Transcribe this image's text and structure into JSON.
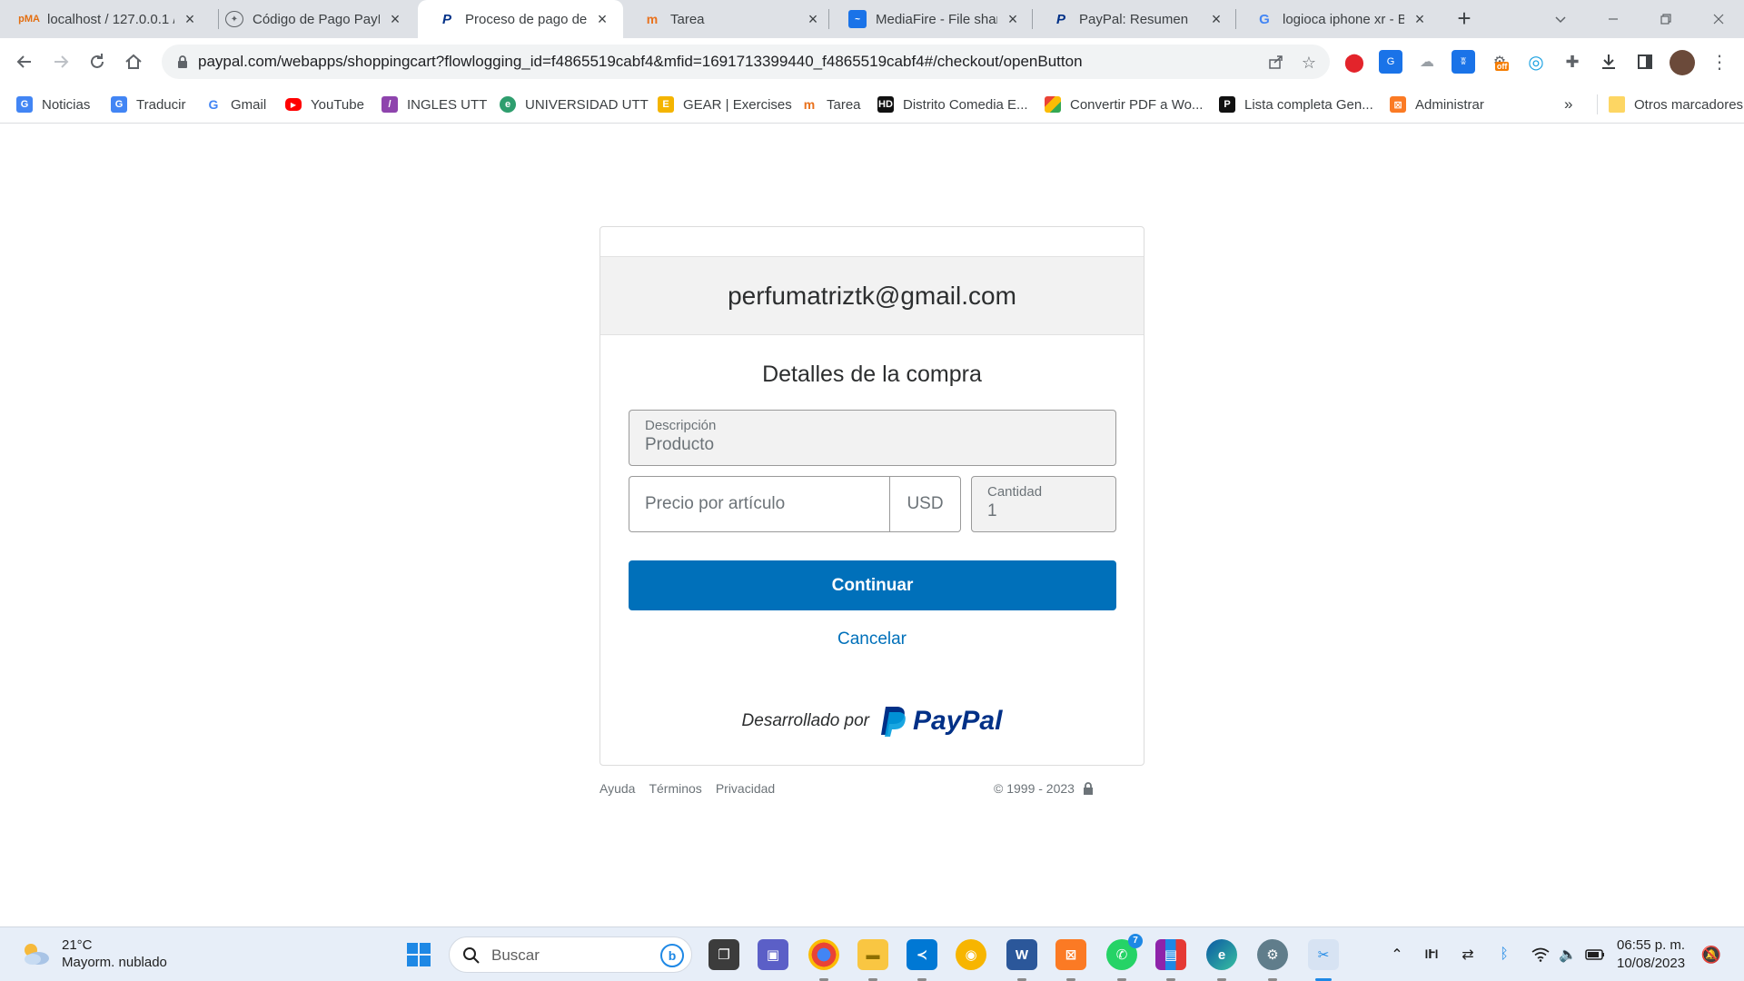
{
  "browser": {
    "tabs": [
      {
        "title": "localhost / 127.0.0.1 /",
        "icon": "phpmyadmin-icon"
      },
      {
        "title": "Código de Pago PayP",
        "icon": "chatgpt-icon"
      },
      {
        "title": "Proceso de pago de P",
        "icon": "paypal-icon",
        "active": true
      },
      {
        "title": "Tarea",
        "icon": "tarea-icon"
      },
      {
        "title": "MediaFire - File sharin",
        "icon": "mediafire-icon"
      },
      {
        "title": "PayPal: Resumen",
        "icon": "paypal-icon"
      },
      {
        "title": "logioca iphone xr - Bu",
        "icon": "google-icon"
      }
    ],
    "url": "paypal.com/webapps/shoppingcart?flowlogging_id=f4865519cabf4&mfid=1691713399440_f4865519cabf4#/checkout/openButton",
    "bookmarks": [
      {
        "label": "Noticias",
        "icon": "google-news-icon"
      },
      {
        "label": "Traducir",
        "icon": "google-translate-icon"
      },
      {
        "label": "Gmail",
        "icon": "google-icon"
      },
      {
        "label": "YouTube",
        "icon": "youtube-icon"
      },
      {
        "label": "INGLES UTT",
        "icon": "ingles-icon"
      },
      {
        "label": "UNIVERSIDAD UTT",
        "icon": "universidad-icon"
      },
      {
        "label": "GEAR | Exercises",
        "icon": "gear-exercises-icon"
      },
      {
        "label": "Tarea",
        "icon": "tarea-icon"
      },
      {
        "label": "Distrito Comedia E...",
        "icon": "distrito-icon"
      },
      {
        "label": "Convertir PDF a Wo...",
        "icon": "pdf-icon"
      },
      {
        "label": "Lista completa Gen...",
        "icon": "p-icon"
      },
      {
        "label": "Administrar",
        "icon": "xampp-icon"
      }
    ],
    "bookmarks_more": "»",
    "other_bookmarks": "Otros marcadores",
    "ext_badge": "off"
  },
  "page": {
    "email": "perfumatriztk@gmail.com",
    "subtitle": "Detalles de la compra",
    "description_label": "Descripción",
    "description_value": "Producto",
    "price_placeholder": "Precio por artículo",
    "currency": "USD",
    "quantity_label": "Cantidad",
    "quantity_value": "1",
    "continue_label": "Continuar",
    "cancel_label": "Cancelar",
    "powered_by": "Desarrollado por",
    "paypal_logo": "PayPal",
    "footer_links": [
      "Ayuda",
      "Términos",
      "Privacidad"
    ],
    "copyright": "© 1999 - 2023"
  },
  "taskbar": {
    "temperature": "21°C",
    "weather": "Mayorm. nublado",
    "search_label": "Buscar",
    "whatsapp_badge": "7",
    "time": "06:55 p. m.",
    "date": "10/08/2023"
  },
  "colors": {
    "paypal_blue": "#0070ba",
    "paypal_navy": "#003087",
    "paypal_light": "#009cde"
  }
}
